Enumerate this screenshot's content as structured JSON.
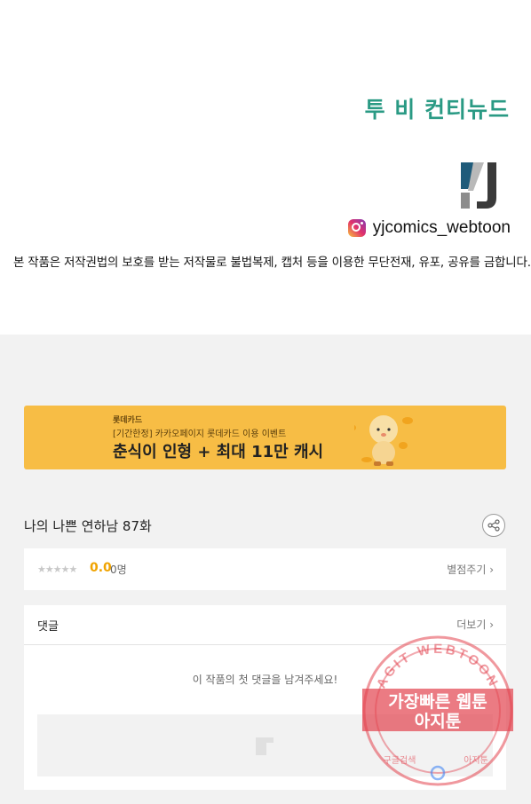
{
  "header": {
    "title": "투 비 컨티뉴드",
    "instagram_handle": "yjcomics_webtoon",
    "copyright_notice": "본 작품은 저작권법의 보호를 받는 저작물로 불법복제, 캡처 등을 이용한 무단전재, 유포, 공유를 금합니다."
  },
  "banner": {
    "brand": "롯데카드",
    "subtitle": "[기간한정] 카카오페이지 롯데카드 이용 이벤트",
    "headline": "춘식이 인형 + 최대 11만 캐시"
  },
  "episode": {
    "title": "나의 나쁜 연하남 87화"
  },
  "rating": {
    "stars": "★★★★★",
    "score": "0.0",
    "count": "0명",
    "rate_link": "별점주기 ›"
  },
  "comments": {
    "title": "댓글",
    "more_link": "더보기 ›",
    "empty_message": "이 작품의 첫 댓글을 남겨주세요!"
  },
  "watermark": {
    "top_text": "AGIT WEBTOON",
    "line1": "가장빠른 웹툰",
    "line2": "아지툰",
    "bottom_left": "구글검색",
    "bottom_right": "아지툰"
  },
  "colors": {
    "title_green": "#2a9a84",
    "banner_yellow": "#f7bd45",
    "score_orange": "#f0a300",
    "watermark_red": "#e3434f"
  }
}
